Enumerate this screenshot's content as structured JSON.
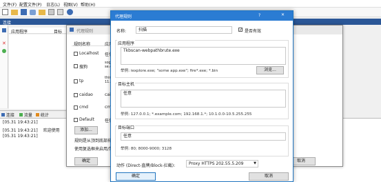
{
  "menubar": {
    "items": [
      "文件(F)",
      "配置文件(P)",
      "日志(L)",
      "视图(V)",
      "帮助(H)"
    ]
  },
  "main": {
    "title": "连接",
    "col_app": "应用程序",
    "col_target": "目标",
    "bottom_tabs": [
      "连接",
      "流量",
      "统计"
    ],
    "log": [
      {
        "time": "[05.31 19:43:21]",
        "text": ""
      },
      {
        "time": "[05.31 19:43:21]",
        "text": "欢迎使用"
      },
      {
        "time": "[05.31 19:43:21]",
        "text": ""
      }
    ]
  },
  "rules_dialog": {
    "title": "代理规则",
    "col_name": "规则名称",
    "col_app": "应用",
    "rows": [
      {
        "name": "Localhost",
        "app": "任何"
      },
      {
        "name": "搜狗",
        "app": "sogo\nse.e"
      },
      {
        "name": "tp",
        "app": "thir\n11.e"
      },
      {
        "name": "caidao",
        "app": "caid"
      },
      {
        "name": "cmd",
        "app": "cmd."
      },
      {
        "name": "Default",
        "app": "任何"
      }
    ],
    "add_label": "添加...",
    "note_line1": "规则是从顶到底部排",
    "note_line2": "使用复选框来启用/禁",
    "ok_label": "确定",
    "cancel_label": "取消"
  },
  "edit_dialog": {
    "title": "代理规则",
    "help_icon": "?",
    "close_icon": "✕",
    "name_label": "名称:",
    "name_value": "扫描",
    "enabled_label": "是否有效",
    "enabled": true,
    "app_group": "应用程序",
    "app_value": "Tkbscan-webpathbrute.exe",
    "app_hint": "举例: iexplore.exe; \"some app.exe\"; fire*.exe; *.bin",
    "browse_label": "浏览...",
    "host_group": "目标主机",
    "host_value": "任意",
    "host_hint": "举例: 127.0.0.1; *.example.com; 192.168.1.*; 10.1.0.0-10.5.255.255",
    "port_group": "目标端口",
    "port_value": "任意",
    "port_hint": "举例: 80; 8000-9000; 3128",
    "action_label": "动作 (Direct-直牌/Block-拦截):",
    "action_value": "Proxy HTTPS 202.55.5.209",
    "ok_label": "确定",
    "cancel_label": "取消"
  },
  "colors": {
    "accent": "#1e73be",
    "title_bar": "#2b7cd3",
    "window_bg": "#f0f0f0"
  }
}
